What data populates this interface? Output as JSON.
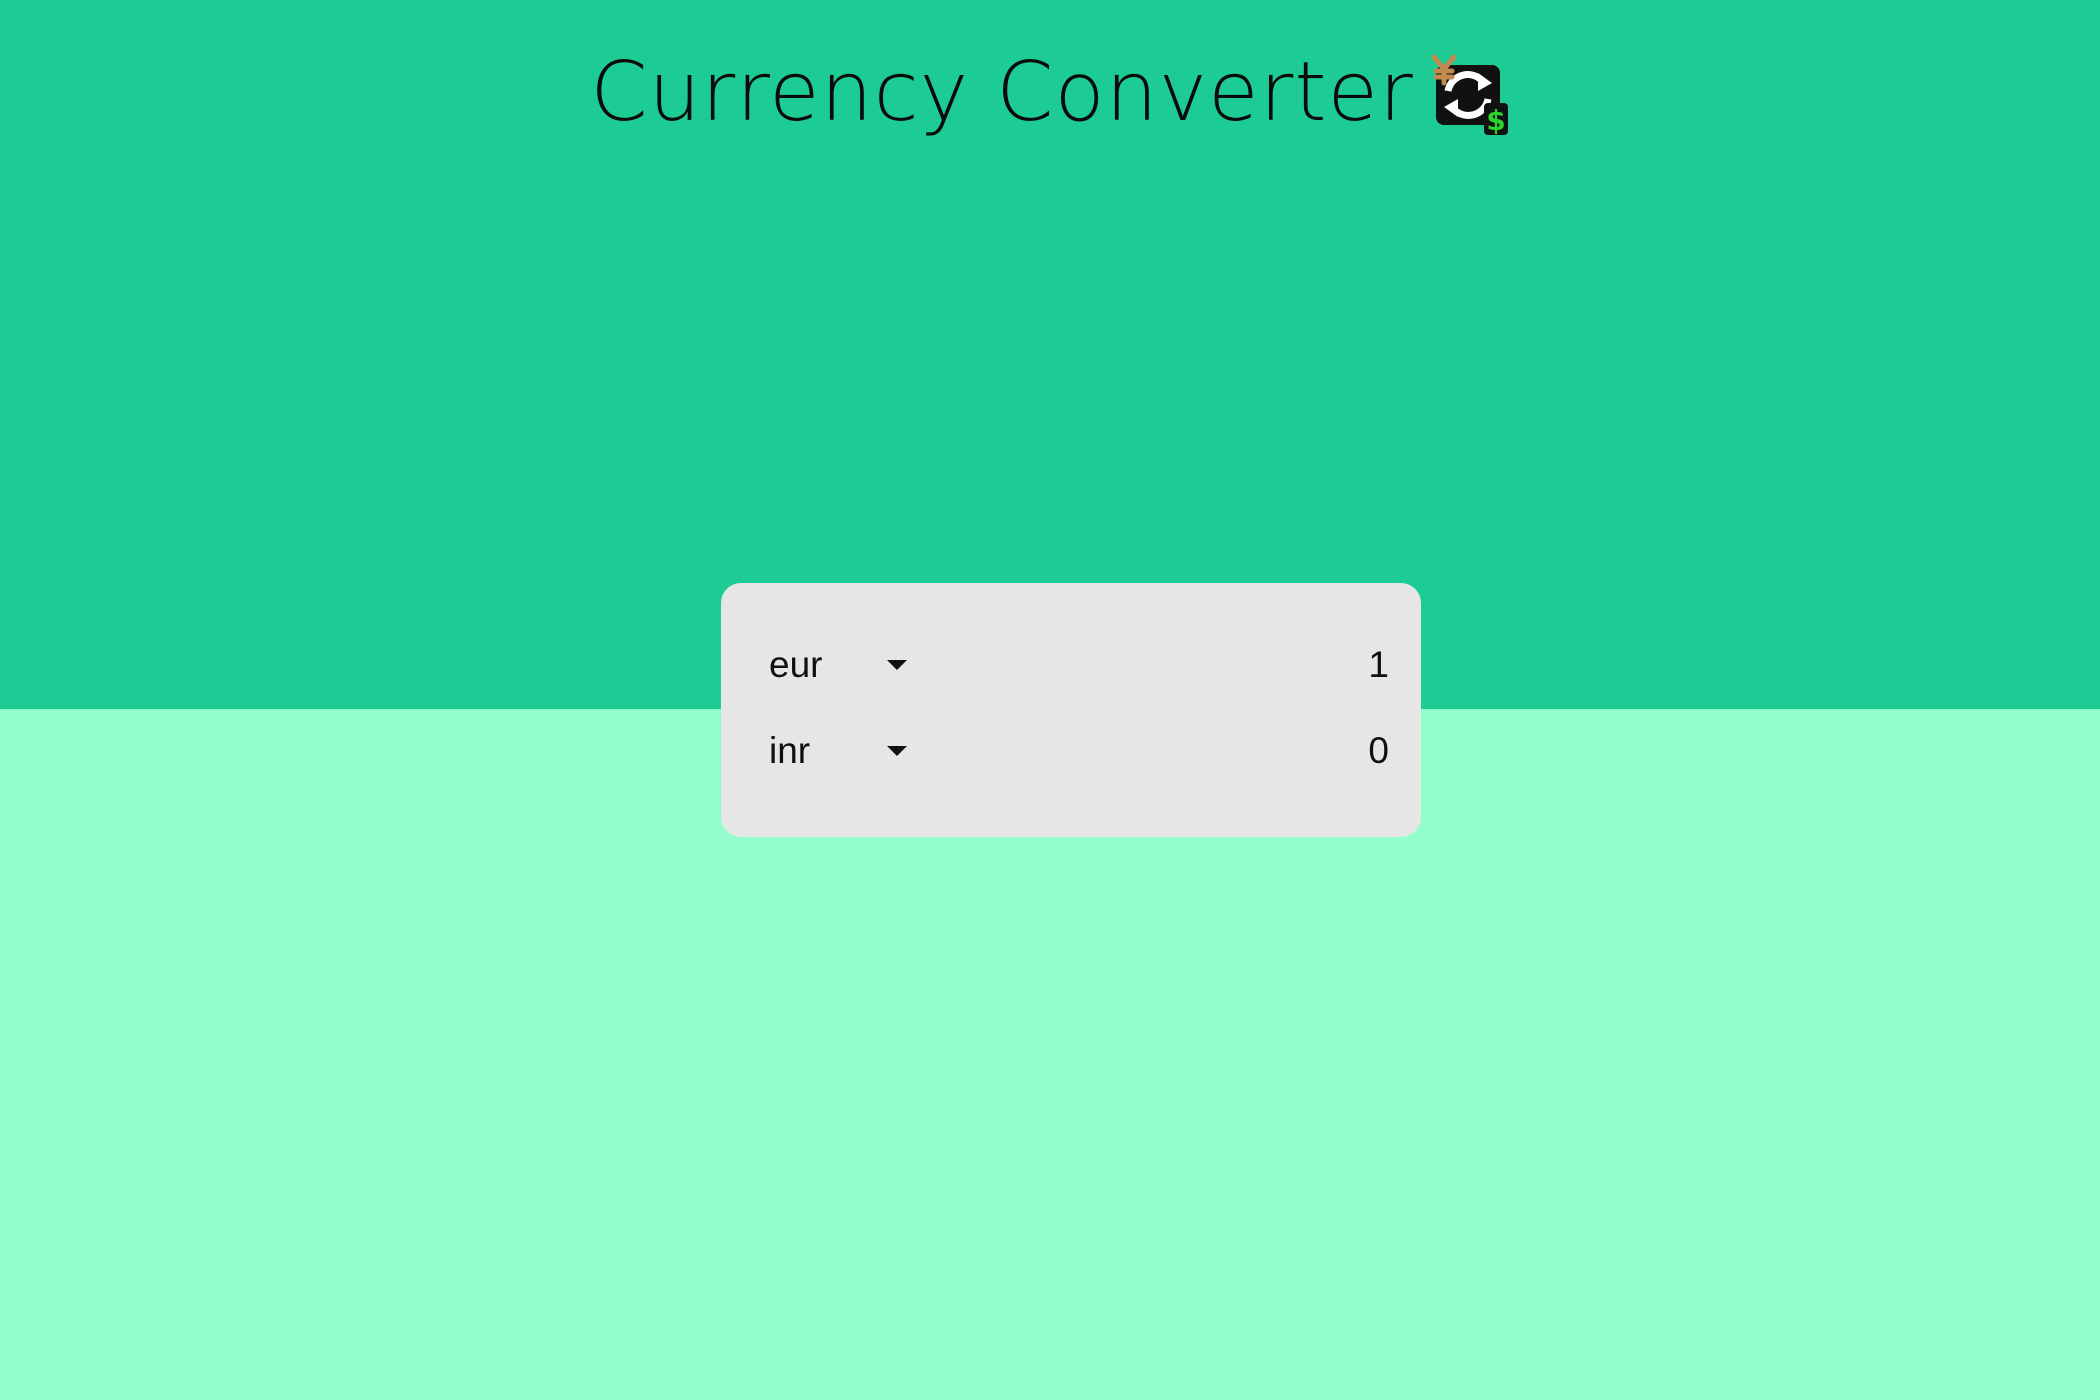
{
  "header": {
    "title": "Currency Converter",
    "icon": "currency-exchange-icon"
  },
  "converter": {
    "from": {
      "currency": "eur",
      "amount": "1"
    },
    "to": {
      "currency": "inr",
      "amount": "0"
    }
  },
  "colors": {
    "top_background": "#1dcc94",
    "bottom_background": "#93fecb",
    "card_background": "#e6e6e6"
  }
}
